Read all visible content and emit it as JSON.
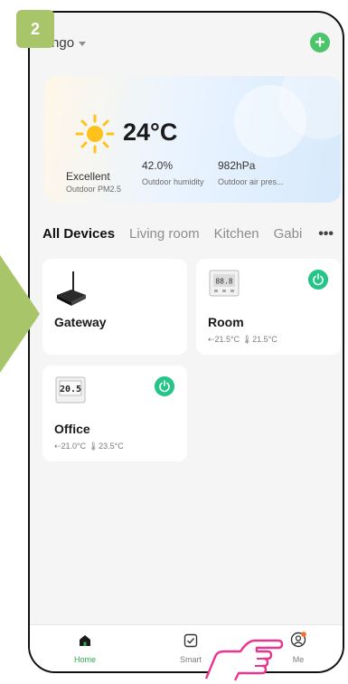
{
  "step_number": "2",
  "header": {
    "home_name": "Engo"
  },
  "weather": {
    "temperature": "24°C",
    "metrics": [
      {
        "value": "Excellent",
        "label": "Outdoor PM2.5"
      },
      {
        "value": "42.0%",
        "label": "Outdoor humidity"
      },
      {
        "value": "982hPa",
        "label": "Outdoor air pres..."
      }
    ]
  },
  "tabs": [
    "All Devices",
    "Living room",
    "Kitchen",
    "Gabi"
  ],
  "more_label": "•••",
  "devices": [
    {
      "name": "Gateway",
      "temps": "",
      "icon": "gateway-icon"
    },
    {
      "name": "Room",
      "temps": "⇠21.5°C  🌡21.5°C",
      "icon": "thermostat-icon",
      "display": "88.8"
    },
    {
      "name": "Office",
      "temps": "⇠21.0°C  🌡23.5°C",
      "icon": "thermostat-icon",
      "display": "20.5"
    }
  ],
  "nav": [
    {
      "label": "Home",
      "icon": "home-icon"
    },
    {
      "label": "Smart",
      "icon": "checkbox-icon"
    },
    {
      "label": "Me",
      "icon": "user-icon"
    }
  ],
  "colors": {
    "accent_green": "#25c489",
    "add_green": "#4cc46a",
    "badge": "#a9c56a",
    "notification": "#ff6a2b"
  }
}
